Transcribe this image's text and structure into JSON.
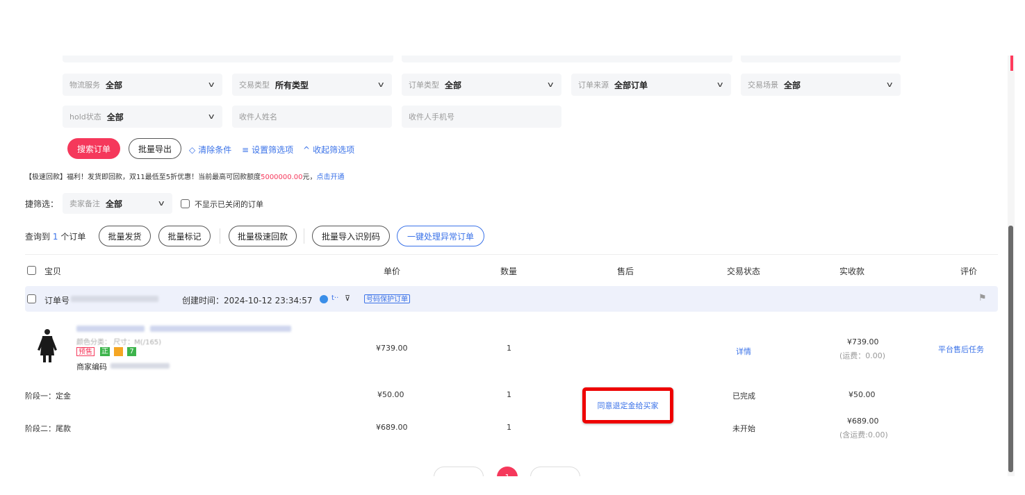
{
  "filters": {
    "row1": [
      {
        "label": "物流服务",
        "value": "全部"
      },
      {
        "label": "交易类型",
        "value": "所有类型"
      },
      {
        "label": "订单类型",
        "value": "全部"
      },
      {
        "label": "订单来源",
        "value": "全部订单"
      },
      {
        "label": "交易场景",
        "value": "全部"
      }
    ],
    "hold": {
      "label": "hold状态",
      "value": "全部"
    },
    "recipient_name_placeholder": "收件人姓名",
    "recipient_phone_placeholder": "收件人手机号"
  },
  "actions": {
    "search": "搜索订单",
    "export": "批量导出",
    "clear": "清除条件",
    "settings": "设置筛选项",
    "collapse": "收起筛选项"
  },
  "promo": {
    "prefix": "【极速回款】福利！发货即回款，双11最低至5折优惠！当前最高可回款额度",
    "amount": "5000000.00",
    "suffix": "元，",
    "link": "点击开通"
  },
  "quick_filter": {
    "label": "捷筛选：",
    "seller_note_label": "卖家备注",
    "seller_note_value": "全部",
    "hide_closed": "不显示已关闭的订单"
  },
  "result": {
    "prefix": "查询到",
    "count": "1",
    "suffix": "个订单",
    "buttons": [
      "批量发货",
      "批量标记",
      "批量极速回款",
      "批量导入识别码"
    ],
    "handle_abnormal": "一键处理异常订单"
  },
  "table": {
    "headers": {
      "item": "宝贝",
      "price": "单价",
      "qty": "数量",
      "after_sale": "售后",
      "status": "交易状态",
      "received": "实收款",
      "review": "评价"
    },
    "order": {
      "order_no_label": "订单号",
      "created_label": "创建时间：",
      "created_time": "2024-10-12 23:34:57",
      "protect_tag": "号码保护订单",
      "icon_text": "t··"
    },
    "item": {
      "tags": {
        "presale": "预售",
        "genuine": "正",
        "seven": "7"
      },
      "sku_code_label": "商家编码",
      "sku_partial": "颜色分类：   尺寸：M(/165)",
      "price": "¥739.00",
      "qty": "1",
      "after_sale_action": "同意退定金给买家",
      "status_link": "详情",
      "received": "¥739.00",
      "shipping": "(运费：0.00)",
      "review_link": "平台售后任务"
    },
    "stages": [
      {
        "name": "阶段一：定金",
        "price": "¥50.00",
        "qty": "1",
        "status": "已完成",
        "received": "¥50.00",
        "note": ""
      },
      {
        "name": "阶段二：尾款",
        "price": "¥689.00",
        "qty": "1",
        "status": "未开始",
        "received": "¥689.00",
        "note": "(含运费:0.00)"
      }
    ]
  },
  "pagination": {
    "current": "1"
  },
  "colors": {
    "accent": "#f5385b",
    "link": "#3a72e8",
    "highlight": "#ee0000"
  }
}
